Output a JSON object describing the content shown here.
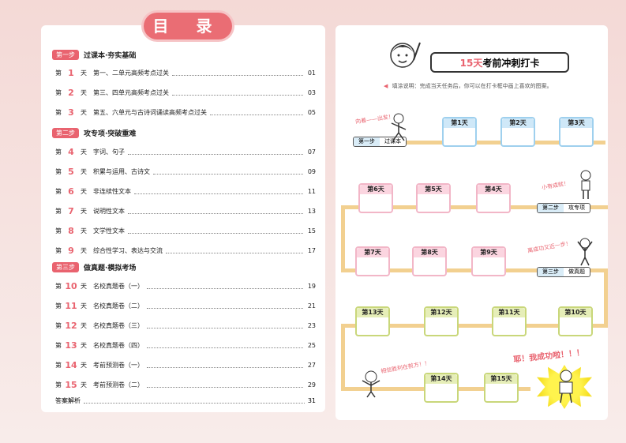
{
  "toc_title": "目 录",
  "sections": [
    {
      "step": "第一步",
      "name": "过课本·夯实基础"
    },
    {
      "step": "第二步",
      "name": "攻专项·突破重难"
    },
    {
      "step": "第三步",
      "name": "做真题·模拟考场"
    }
  ],
  "entries": [
    {
      "pre": "第",
      "num": "1",
      "post": "天",
      "title": "第一、二单元高频考点过关",
      "page": "01"
    },
    {
      "pre": "第",
      "num": "2",
      "post": "天",
      "title": "第三、四单元高频考点过关",
      "page": "03"
    },
    {
      "pre": "第",
      "num": "3",
      "post": "天",
      "title": "第五、六单元与古诗词诵读高频考点过关",
      "page": "05"
    },
    {
      "pre": "第",
      "num": "4",
      "post": "天",
      "title": "字词、句子",
      "page": "07"
    },
    {
      "pre": "第",
      "num": "5",
      "post": "天",
      "title": "积累与运用、古诗文",
      "page": "09"
    },
    {
      "pre": "第",
      "num": "6",
      "post": "天",
      "title": "非连续性文本",
      "page": "11"
    },
    {
      "pre": "第",
      "num": "7",
      "post": "天",
      "title": "说明性文本",
      "page": "13"
    },
    {
      "pre": "第",
      "num": "8",
      "post": "天",
      "title": "文学性文本",
      "page": "15"
    },
    {
      "pre": "第",
      "num": "9",
      "post": "天",
      "title": "综合性学习、表达与交流",
      "page": "17"
    },
    {
      "pre": "第",
      "num": "10",
      "post": "天",
      "title": "名校真题卷（一）",
      "page": "19"
    },
    {
      "pre": "第",
      "num": "11",
      "post": "天",
      "title": "名校真题卷（二）",
      "page": "21"
    },
    {
      "pre": "第",
      "num": "12",
      "post": "天",
      "title": "名校真题卷（三）",
      "page": "23"
    },
    {
      "pre": "第",
      "num": "13",
      "post": "天",
      "title": "名校真题卷（四）",
      "page": "25"
    },
    {
      "pre": "第",
      "num": "14",
      "post": "天",
      "title": "考前预测卷（一）",
      "page": "27"
    },
    {
      "pre": "第",
      "num": "15",
      "post": "天",
      "title": "考前预测卷（二）",
      "page": "29"
    }
  ],
  "answers": {
    "label": "答案解析",
    "page": "31"
  },
  "banner": {
    "red": "15天",
    "rest": "考前冲刺打卡"
  },
  "note": "填涂说明：完成当天任务后，你可以在打卡框中画上喜欢的图案。",
  "days": [
    "第1天",
    "第2天",
    "第3天",
    "第4天",
    "第5天",
    "第6天",
    "第7天",
    "第8天",
    "第9天",
    "第10天",
    "第11天",
    "第12天",
    "第13天",
    "第14天",
    "第15天"
  ],
  "stages": [
    {
      "step": "第一步",
      "name": "过课本"
    },
    {
      "step": "第二步",
      "name": "攻专项"
    },
    {
      "step": "第三步",
      "name": "做真题"
    }
  ],
  "hand_notes": [
    "向着——出发！",
    "小有成就！",
    "离成功又近一步！",
    "相信胜利在前方！！"
  ],
  "final": "耶！我成功啦！！！",
  "colors": {
    "accent": "#e9636f",
    "blue": "#9fd0ee",
    "pink": "#f2b6c7",
    "green": "#c9d77a",
    "path": "#f2d090"
  }
}
